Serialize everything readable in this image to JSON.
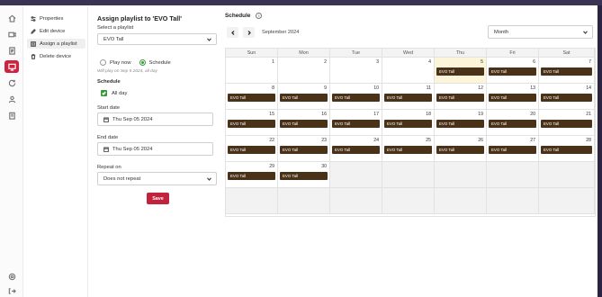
{
  "nav": {
    "items": [
      {
        "label": "Properties",
        "icon": "sliders-icon",
        "active": false
      },
      {
        "label": "Edit device",
        "icon": "edit-icon",
        "active": false
      },
      {
        "label": "Assign a playlist",
        "icon": "playlist-icon",
        "active": true
      },
      {
        "label": "Delete device",
        "icon": "trash-icon",
        "active": false
      }
    ]
  },
  "rail": {
    "icons": [
      "home-icon",
      "media-icon",
      "playlist-icon",
      "display-icon",
      "schedule-icon",
      "users-icon",
      "building-icon",
      "settings-icon",
      "logout-icon"
    ],
    "active": "display-icon"
  },
  "form": {
    "title": "Assign playlist to 'EVO Tall'",
    "playlist_label": "Select a playlist",
    "playlist_value": "EVO Tall",
    "play_now_label": "Play now",
    "schedule_label": "Schedule",
    "selected_mode": "schedule",
    "hint": "Will play on Sep 5 2024, all day",
    "schedule_heading": "Schedule",
    "all_day_label": "All day",
    "all_day_checked": true,
    "start_label": "Start date",
    "start_value": "Thu Sep 05 2024",
    "end_label": "End date",
    "end_value": "Thu Sep 05 2024",
    "repeat_label": "Repeat on",
    "repeat_value": "Does not repeat",
    "save_label": "Save"
  },
  "calendar": {
    "title": "Schedule",
    "info_glyph": "i",
    "month_label": "September 2024",
    "view_value": "Month",
    "weekdays": [
      "Sun",
      "Mon",
      "Tue",
      "Wed",
      "Thu",
      "Fri",
      "Sat"
    ],
    "weeks": [
      [
        "",
        "",
        "",
        "",
        "",
        "",
        ""
      ],
      [
        "",
        "",
        "",
        "",
        "",
        "",
        ""
      ],
      [
        "",
        "",
        "",
        "",
        "",
        "",
        ""
      ],
      [
        "",
        "",
        "",
        "",
        "",
        "",
        ""
      ],
      [
        "",
        "",
        "",
        "",
        "",
        "",
        ""
      ],
      [
        "",
        "",
        "",
        "",
        "",
        "",
        ""
      ]
    ],
    "days": [
      [
        1,
        2,
        3,
        4,
        5,
        6,
        7
      ],
      [
        8,
        9,
        10,
        11,
        12,
        13,
        14
      ],
      [
        15,
        16,
        17,
        18,
        19,
        20,
        21
      ],
      [
        22,
        23,
        24,
        25,
        26,
        27,
        28
      ],
      [
        29,
        30,
        null,
        null,
        null,
        null,
        null
      ],
      [
        null,
        null,
        null,
        null,
        null,
        null,
        null
      ]
    ],
    "today": 5,
    "event_label": "EVO Tall",
    "event_days": [
      5,
      6,
      7,
      8,
      9,
      10,
      11,
      12,
      13,
      14,
      15,
      16,
      17,
      18,
      19,
      20,
      21,
      22,
      23,
      24,
      25,
      26,
      27,
      28,
      29,
      30
    ],
    "colors": {
      "event": "#4a3219",
      "today": "#fdf5d9",
      "accent": "#d0223f",
      "check": "#3a9a3a"
    }
  }
}
